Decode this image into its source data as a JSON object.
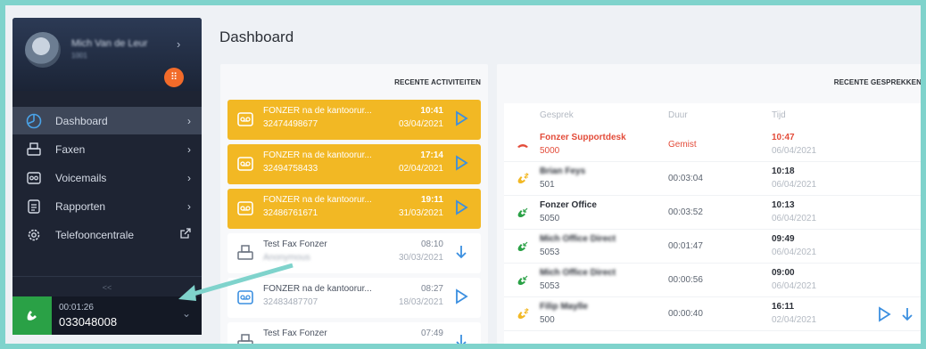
{
  "profile": {
    "name": "Mich Van de Leur",
    "sub": "1001"
  },
  "nav": {
    "items": [
      {
        "label": "Dashboard",
        "icon": "dashboard-icon",
        "active": true
      },
      {
        "label": "Faxen",
        "icon": "printer-icon"
      },
      {
        "label": "Voicemails",
        "icon": "voicemail-icon"
      },
      {
        "label": "Rapporten",
        "icon": "report-icon"
      },
      {
        "label": "Telefooncentrale",
        "icon": "gear-icon"
      }
    ],
    "collapse": "<<"
  },
  "active_call": {
    "duration": "00:01:26",
    "number": "033048008"
  },
  "page": {
    "title": "Dashboard"
  },
  "activities": {
    "header": "RECENTE ACTIVITEITEN",
    "items": [
      {
        "title": "FONZER na de kantoorur...",
        "sub": "32474498677",
        "time": "10:41",
        "date": "03/04/2021",
        "kind": "voicemail"
      },
      {
        "title": "FONZER na de kantoorur...",
        "sub": "32494758433",
        "time": "17:14",
        "date": "02/04/2021",
        "kind": "voicemail"
      },
      {
        "title": "FONZER na de kantoorur...",
        "sub": "32486761671",
        "time": "19:11",
        "date": "31/03/2021",
        "kind": "voicemail"
      },
      {
        "title": "Test Fax Fonzer",
        "sub": "Anonymous",
        "time": "08:10",
        "date": "30/03/2021",
        "kind": "fax"
      },
      {
        "title": "FONZER na de kantoorur...",
        "sub": "32483487707",
        "time": "08:27",
        "date": "18/03/2021",
        "kind": "voicemail"
      },
      {
        "title": "Test Fax Fonzer",
        "sub": "",
        "time": "07:49",
        "date": "",
        "kind": "fax"
      }
    ]
  },
  "calls": {
    "header": "RECENTE GESPREKKEN",
    "columns": {
      "conversation": "Gesprek",
      "duration": "Duur",
      "time": "Tijd"
    },
    "rows": [
      {
        "name": "Fonzer Supportdesk",
        "ext": "5000",
        "duration": "Gemist",
        "time": "10:47",
        "date": "06/04/2021",
        "status": "missed"
      },
      {
        "name": "Brian Feys",
        "ext": "501",
        "duration": "00:03:04",
        "time": "10:18",
        "date": "06/04/2021",
        "status": "transfer",
        "blur": true
      },
      {
        "name": "Fonzer Office",
        "ext": "5050",
        "duration": "00:03:52",
        "time": "10:13",
        "date": "06/04/2021",
        "status": "incoming"
      },
      {
        "name": "Mich Office Direct",
        "ext": "5053",
        "duration": "00:01:47",
        "time": "09:49",
        "date": "06/04/2021",
        "status": "incoming",
        "blur": true
      },
      {
        "name": "Mich Office Direct",
        "ext": "5053",
        "duration": "00:00:56",
        "time": "09:00",
        "date": "06/04/2021",
        "status": "incoming",
        "blur": true
      },
      {
        "name": "Filip Maylle",
        "ext": "500",
        "duration": "00:00:40",
        "time": "16:11",
        "date": "02/04/2021",
        "status": "transfer",
        "blur": true
      }
    ]
  },
  "colors": {
    "accent_yellow": "#f2b824",
    "play_blue": "#3b8fe0",
    "missed_red": "#e34c3a",
    "call_green": "#2aa146",
    "sidebar": "#1e2433"
  }
}
